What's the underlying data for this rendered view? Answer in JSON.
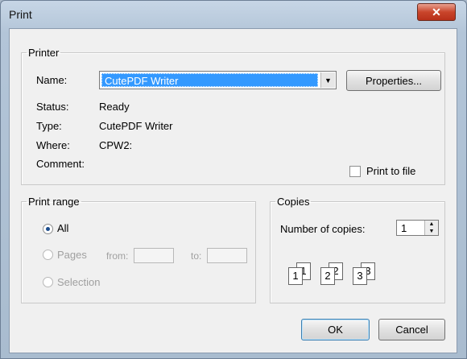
{
  "window": {
    "title": "Print",
    "close_glyph": "✕"
  },
  "printer": {
    "legend": "Printer",
    "name_label": "Name:",
    "name_value": "CutePDF Writer",
    "properties_button": "Properties...",
    "status_label": "Status:",
    "status_value": "Ready",
    "type_label": "Type:",
    "type_value": "CutePDF Writer",
    "where_label": "Where:",
    "where_value": "CPW2:",
    "comment_label": "Comment:",
    "comment_value": "",
    "print_to_file_label": "Print to file",
    "print_to_file_checked": false
  },
  "print_range": {
    "legend": "Print range",
    "all_label": "All",
    "pages_label": "Pages",
    "from_label": "from:",
    "to_label": "to:",
    "selection_label": "Selection",
    "selected": "All"
  },
  "copies": {
    "legend": "Copies",
    "number_label": "Number of copies:",
    "number_value": "1",
    "collate_pages": [
      "1",
      "2",
      "3"
    ]
  },
  "buttons": {
    "ok": "OK",
    "cancel": "Cancel"
  },
  "icons": {
    "dropdown": "chevron-down-icon",
    "spin_up": "▲",
    "spin_down": "▼",
    "combo_arrow": "▼"
  },
  "colors": {
    "selection": "#3399ff",
    "close": "#c9452b"
  }
}
